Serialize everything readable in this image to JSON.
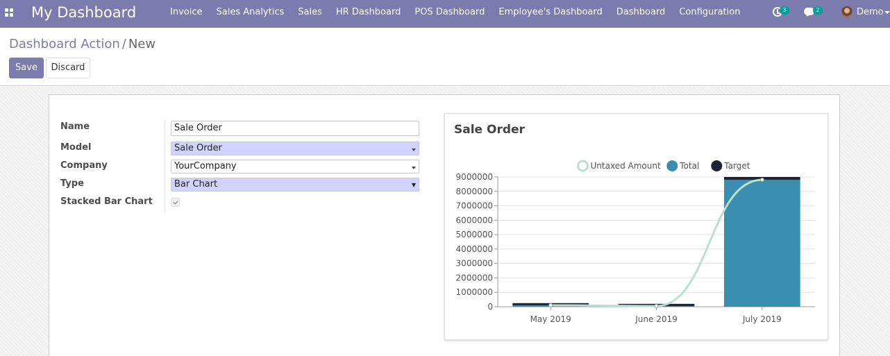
{
  "navbar": {
    "brand": "My Dashboard",
    "menu": [
      "Invoice",
      "Sales Analytics",
      "Sales",
      "HR Dashboard",
      "POS Dashboard",
      "Employee's Dashboard",
      "Dashboard",
      "Configuration"
    ],
    "activity_count": "3",
    "message_count": "2",
    "user_name": "Demo"
  },
  "breadcrumb": {
    "parent": "Dashboard Action",
    "separator": "/",
    "current": "New"
  },
  "buttons": {
    "save": "Save",
    "discard": "Discard"
  },
  "form": {
    "name_label": "Name",
    "name_value": "Sale Order",
    "model_label": "Model",
    "model_value": "Sale Order",
    "company_label": "Company",
    "company_value": "YourCompany",
    "type_label": "Type",
    "type_value": "Bar Chart",
    "stacked_label": "Stacked Bar Chart",
    "stacked_checked": true
  },
  "chart_data": {
    "type": "bar",
    "title": "Sale Order",
    "stacked": true,
    "categories": [
      "May 2019",
      "June 2019",
      "July 2019"
    ],
    "series": [
      {
        "name": "Untaxed Amount",
        "kind": "line",
        "color": "#b8e0cf",
        "values": [
          100000,
          50000,
          8800000
        ]
      },
      {
        "name": "Total",
        "kind": "bar",
        "color": "#3a8fb0",
        "values": [
          100000,
          50000,
          8800000
        ]
      },
      {
        "name": "Target",
        "kind": "bar",
        "color": "#1b2434",
        "values": [
          150000,
          150000,
          200000
        ]
      }
    ],
    "ylim": [
      0,
      9000000
    ],
    "yticks": [
      0,
      1000000,
      2000000,
      3000000,
      4000000,
      5000000,
      6000000,
      7000000,
      8000000,
      9000000
    ],
    "legend_position": "top-center",
    "grid": true
  }
}
